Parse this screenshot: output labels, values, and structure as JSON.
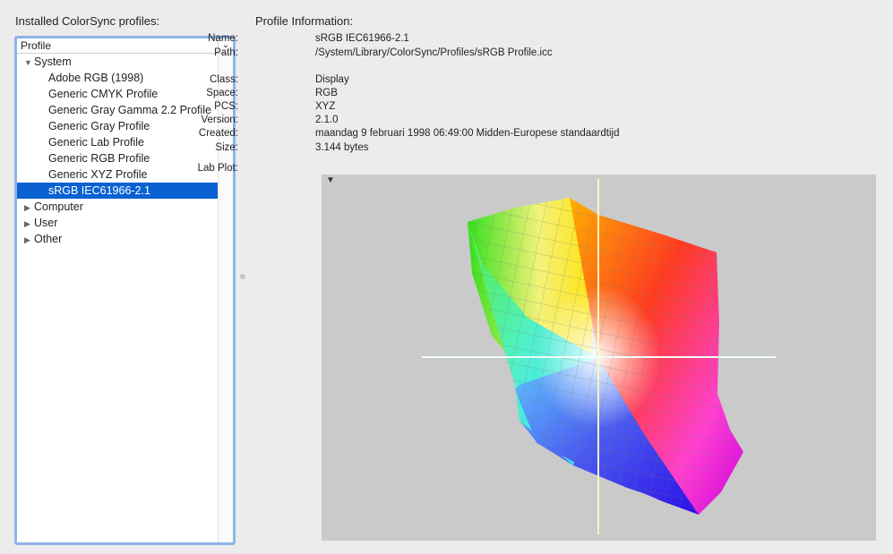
{
  "left_title": "Installed ColorSync profiles:",
  "column_header": "Profile",
  "tree": {
    "system": {
      "label": "System",
      "items": [
        "Adobe RGB (1998)",
        "Generic CMYK Profile",
        "Generic Gray Gamma 2.2 Profile",
        "Generic Gray Profile",
        "Generic Lab Profile",
        "Generic RGB Profile",
        "Generic XYZ Profile",
        "sRGB IEC61966-2.1"
      ]
    },
    "computer": "Computer",
    "user": "User",
    "other": "Other"
  },
  "selected_profile": "sRGB IEC61966-2.1",
  "info_title": "Profile Information:",
  "info": {
    "name_label": "Name:",
    "name": "sRGB IEC61966-2.1",
    "path_label": "Path:",
    "path": "/System/Library/ColorSync/Profiles/sRGB Profile.icc",
    "class_label": "Class:",
    "class": "Display",
    "space_label": "Space:",
    "space": "RGB",
    "pcs_label": "PCS:",
    "pcs": "XYZ",
    "version_label": "Version:",
    "version": "2.1.0",
    "created_label": "Created:",
    "created": "maandag 9 februari 1998 06:49:00 Midden-Europese standaardtijd",
    "size_label": "Size:",
    "size": "3.144 bytes",
    "labplot_label": "Lab Plot:"
  },
  "colors": {
    "selection": "#0a62d2",
    "focus_ring": "#8db4e8",
    "plot_bg": "#cacaca"
  }
}
